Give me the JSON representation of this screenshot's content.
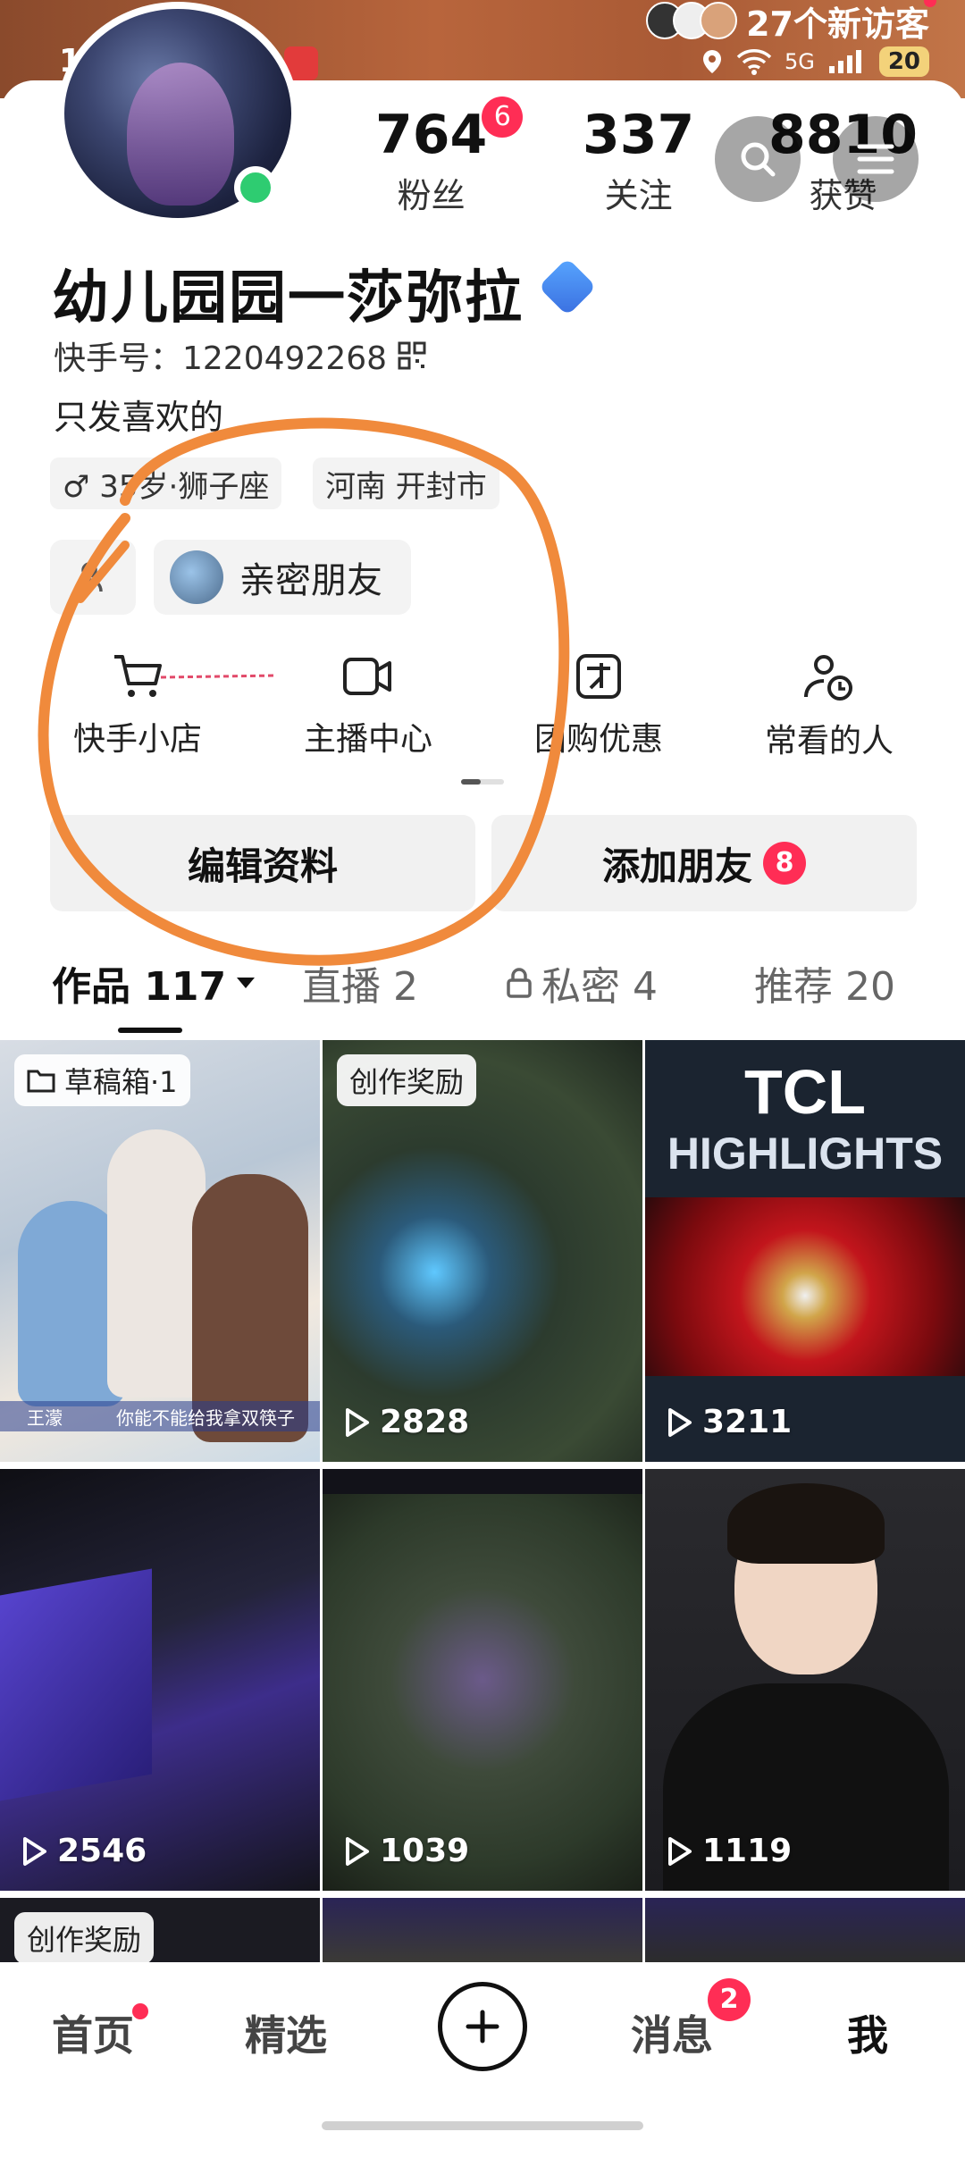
{
  "status_bar": {
    "time": "15:31",
    "network": "5G",
    "battery": "20",
    "visitor_text": "27个新访客"
  },
  "profile": {
    "name": "幼儿园园一莎弥拉",
    "id_label": "快手号：1220492268",
    "bio": "只发喜欢的",
    "tags": [
      {
        "label": "♂ 35岁·狮子座"
      },
      {
        "label": "河南 开封市"
      }
    ],
    "friend_chip": "亲密朋友",
    "stats": [
      {
        "num": "764",
        "label": "粉丝",
        "badge": "6"
      },
      {
        "num": "337",
        "label": "关注"
      },
      {
        "num": "8810",
        "label": "获赞"
      }
    ]
  },
  "shortcuts": [
    {
      "label": "快手小店",
      "icon": "cart-icon"
    },
    {
      "label": "主播中心",
      "icon": "camera-icon"
    },
    {
      "label": "团购优惠",
      "icon": "group-buy-icon"
    },
    {
      "label": "常看的人",
      "icon": "frequent-people-icon"
    }
  ],
  "actions": {
    "edit": "编辑资料",
    "add_friend": "添加朋友",
    "add_friend_badge": "8"
  },
  "tabs": [
    {
      "label": "作品 117"
    },
    {
      "label": "直播 2"
    },
    {
      "label": "私密 4"
    },
    {
      "label": "推荐 20"
    }
  ],
  "grid": [
    {
      "overlay": "草稿箱·1",
      "subtitle": "你能不能给我拿双筷子",
      "speaker": "王濛"
    },
    {
      "overlay": "创作奖励",
      "plays": "2828"
    },
    {
      "title_top": "TCL",
      "title_bottom": "HIGHLIGHTS",
      "plays": "3211"
    },
    {
      "plays": "2546"
    },
    {
      "plays": "1039"
    },
    {
      "plays": "1119"
    },
    {
      "overlay": "创作奖励"
    },
    {},
    {}
  ],
  "bottom_nav": {
    "home": "首页",
    "featured": "精选",
    "messages": "消息",
    "messages_badge": "2",
    "me": "我"
  },
  "colors": {
    "accent_red": "#ff2d55",
    "annotation_orange": "#f08a3c"
  }
}
